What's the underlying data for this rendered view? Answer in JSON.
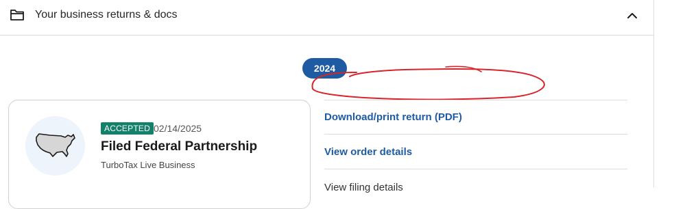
{
  "header": {
    "title": "Your business returns & docs",
    "folder_icon": "folder-icon",
    "collapse_icon": "chevron-up-icon"
  },
  "year": {
    "label": "2024"
  },
  "return_card": {
    "status": "ACCEPTED",
    "date": "02/14/2025",
    "title": "Filed Federal Partnership",
    "subtitle": "TurboTax Live Business",
    "icon": "us-map-icon"
  },
  "actions": {
    "download": "Download/print return (PDF)",
    "order": "View order details",
    "filing": "View filing details"
  },
  "colors": {
    "accent": "#1e5ba3",
    "accepted": "#13806a",
    "annotation": "#d8232a"
  }
}
